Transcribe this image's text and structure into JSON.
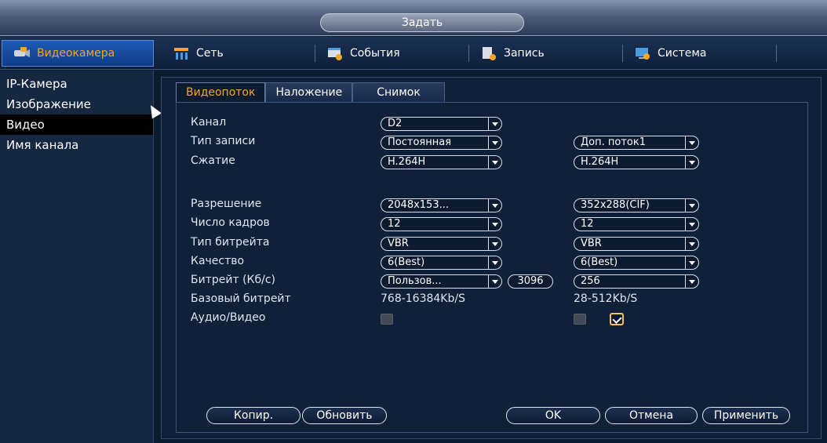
{
  "window": {
    "title": "Задать"
  },
  "top_tabs": [
    {
      "label": "Видеокамера",
      "icon": "camera-icon"
    },
    {
      "label": "Сеть",
      "icon": "network-icon"
    },
    {
      "label": "События",
      "icon": "events-icon"
    },
    {
      "label": "Запись",
      "icon": "record-icon"
    },
    {
      "label": "Система",
      "icon": "system-icon"
    }
  ],
  "sidebar": {
    "items": [
      {
        "label": "IP-Камера"
      },
      {
        "label": "Изображение"
      },
      {
        "label": "Видео"
      },
      {
        "label": "Имя канала"
      }
    ]
  },
  "sub_tabs": [
    {
      "label": "Видеопоток"
    },
    {
      "label": "Наложение"
    },
    {
      "label": "Снимок"
    }
  ],
  "form": {
    "channel_label": "Канал",
    "channel_value": "D2",
    "record_type_label": "Тип записи",
    "record_type_value": "Постоянная",
    "stream2_value": "Доп. поток1",
    "compression_label": "Сжатие",
    "compression_main": "H.264H",
    "compression_sub": "H.264H",
    "resolution_label": "Разрешение",
    "resolution_main": "2048x153...",
    "resolution_sub": "352x288(CIF)",
    "fps_label": "Число кадров",
    "fps_main": "12",
    "fps_sub": "12",
    "bitrate_type_label": "Тип битрейта",
    "bitrate_type_main": "VBR",
    "bitrate_type_sub": "VBR",
    "quality_label": "Качество",
    "quality_main": "6(Best)",
    "quality_sub": "6(Best)",
    "bitrate_label": "Битрейт (Кб/с)",
    "bitrate_main": "Пользов...",
    "bitrate_custom": "3096",
    "bitrate_sub": "256",
    "base_bitrate_label": "Базовый битрейт",
    "base_bitrate_main": "768-16384Kb/S",
    "base_bitrate_sub": "28-512Kb/S",
    "audio_video_label": "Аудио/Видео",
    "audio_video_main_checked": false,
    "audio_video_sub_checked": false,
    "audio_video_sub2_checked": true
  },
  "buttons": {
    "copy": "Копир.",
    "refresh": "Обновить",
    "ok": "OK",
    "cancel": "Отмена",
    "apply": "Применить"
  },
  "colors": {
    "accent": "#f5a623",
    "background": "#0d1b31",
    "active_tab": "#1e5ab8"
  }
}
